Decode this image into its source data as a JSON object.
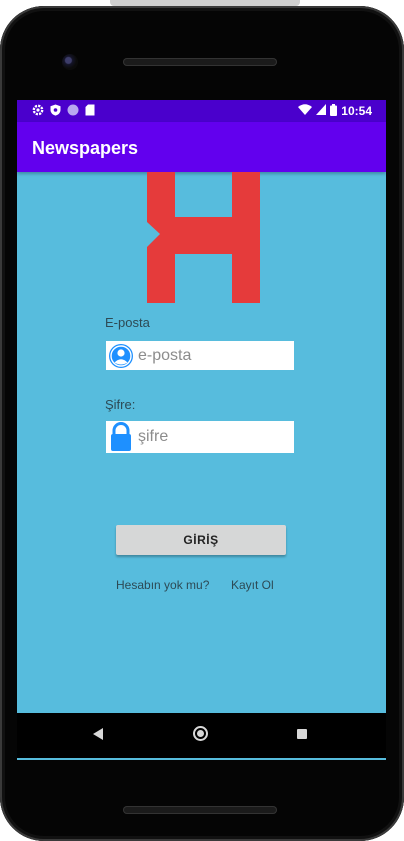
{
  "status_bar": {
    "time": "10:54",
    "left_icons": [
      "gear-icon",
      "shield-icon",
      "circle-icon",
      "sd-card-icon"
    ],
    "right_icons": [
      "wifi-icon",
      "signal-icon",
      "battery-icon"
    ]
  },
  "app_bar": {
    "title": "Newspapers"
  },
  "logo": {
    "icon": "logo-h-icon",
    "color": "#e53b3b"
  },
  "form": {
    "email_label": "E-posta",
    "email_placeholder": "e-posta",
    "email_icon": "account-circle-icon",
    "password_label": "Şifre:",
    "password_placeholder": "şifre",
    "password_icon": "lock-icon",
    "login_button": "GİRİŞ"
  },
  "footer": {
    "no_account_text": "Hesabın yok mu?",
    "register_link": "Kayıt Ol"
  },
  "nav": {
    "icons": [
      "back-icon",
      "home-icon",
      "recent-apps-icon"
    ]
  },
  "colors": {
    "status_bar": "#4a00cc",
    "app_bar": "#6200ee",
    "background": "#57bcdd",
    "icon_blue": "#1e90ff"
  }
}
